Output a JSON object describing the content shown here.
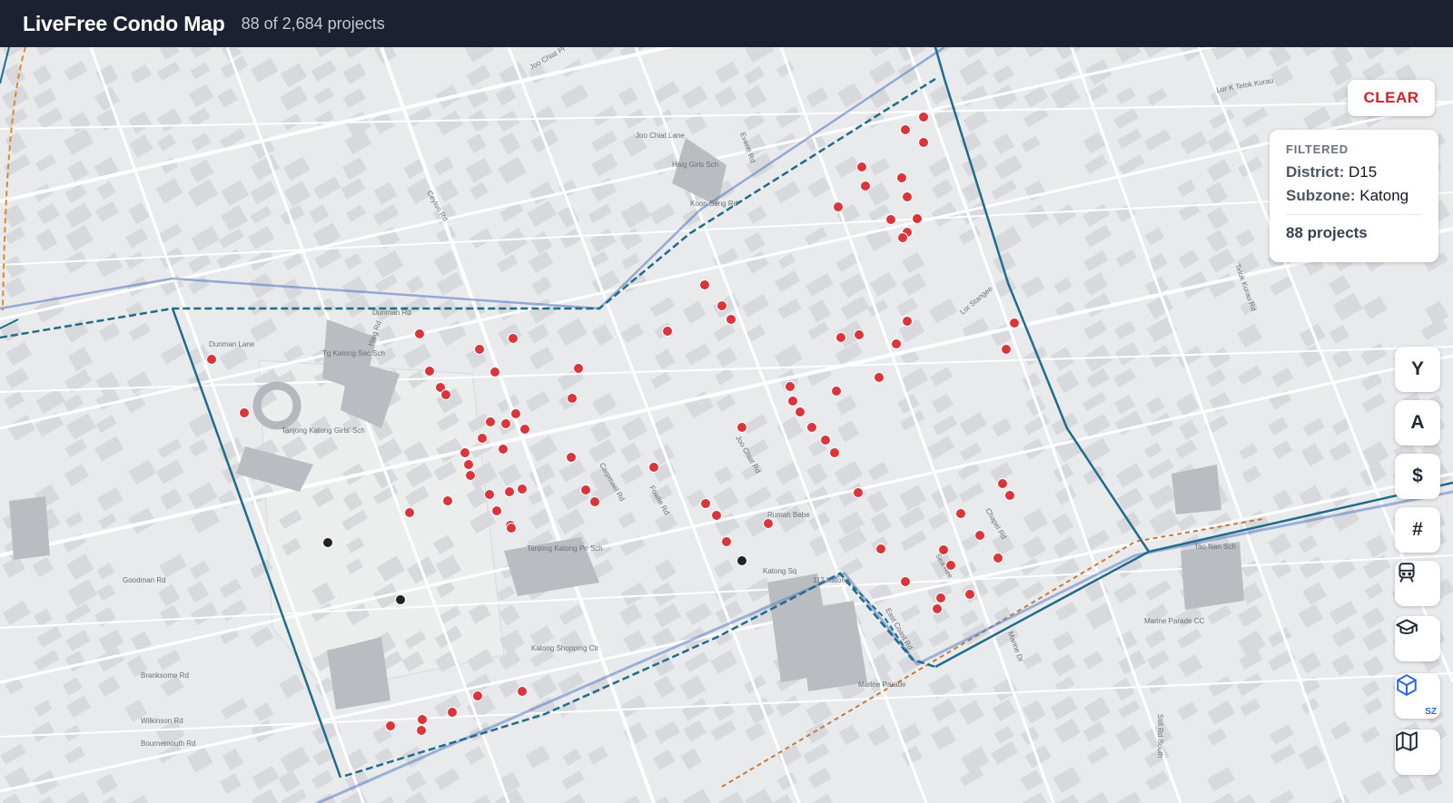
{
  "header": {
    "title": "LiveFree Condo Map",
    "count": "88 of 2,684 projects"
  },
  "clear_button": "CLEAR",
  "filter_card": {
    "heading": "FILTERED",
    "district_label": "District:",
    "district_value": "D15",
    "subzone_label": "Subzone:",
    "subzone_value": "Katong",
    "total": "88 projects"
  },
  "side_buttons": {
    "year": "Y",
    "area": "A",
    "price": "$",
    "count": "#",
    "sz_tag": "SZ"
  },
  "icons": [
    "train-icon",
    "graduation-cap-icon",
    "cube-icon",
    "map-icon"
  ],
  "colors": {
    "header_bg": "#1b2130",
    "marker_red": "#d9353b",
    "marker_black": "#222222",
    "boundary_blue": "#1f6d8a",
    "clear_red": "#d3202a"
  },
  "map_labels": [
    "Joo Chiat Pl",
    "Joo Chiat Lane",
    "Haig Rd",
    "Dunman Lane",
    "Dunman Rd",
    "Tg Katong Sec Sch",
    "Tanjong Katong Girls' Sch",
    "Tanjong Katong Pri Sch",
    "Marine Parade",
    "Katong Sq",
    "112 Katong",
    "Katong Shopping Ctr",
    "East Coast Rd",
    "Lor K Telok Kurau",
    "Tao Nan Sch",
    "Marine Parade CC",
    "Haig Girls Sch",
    "Koon Seng Rd",
    "Joo Chiat Rd",
    "Still Rd South",
    "Wilkinson Rd",
    "Goodman Rd",
    "Branksome Rd",
    "Bournemouth Rd",
    "Ceylon Rd",
    "Carpmael Rd",
    "Fowlie Rd",
    "Rumah Bebe",
    "Marine Dr",
    "Sea Ave",
    "Chapel Rd",
    "Lor Stangee",
    "Everitt Rd",
    "Telok Kurau Rd"
  ]
}
